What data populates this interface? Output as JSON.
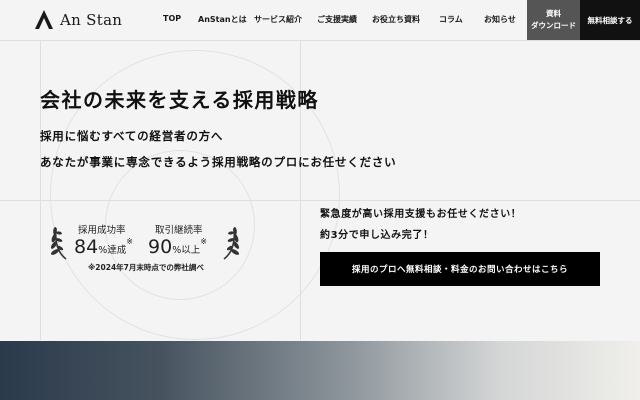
{
  "header": {
    "logo_text": "An Stan",
    "nav": [
      {
        "id": "top",
        "label": "TOP"
      },
      {
        "id": "about",
        "label": "AnStanとは"
      },
      {
        "id": "services",
        "label": "サービス紹介"
      },
      {
        "id": "cases",
        "label": "ご支援実績"
      },
      {
        "id": "resources",
        "label": "お役立ち資料"
      },
      {
        "id": "column",
        "label": "コラム"
      },
      {
        "id": "news",
        "label": "お知らせ"
      }
    ],
    "download_button": {
      "line1": "資料",
      "line2": "ダウンロード"
    },
    "consult_button": "無料相談する"
  },
  "hero": {
    "title": "会社の未来を支える採用戦略",
    "subtitle_line1": "採用に悩むすべての経営者の方へ",
    "subtitle_line2": "あなたが事業に専念できるよう採用戦略のプロにお任せください"
  },
  "stats": {
    "items": [
      {
        "label": "採用成功率",
        "value": "84",
        "unit": "%達成",
        "mark": "※"
      },
      {
        "label": "取引継続率",
        "value": "90",
        "unit": "%以上",
        "mark": "※"
      }
    ],
    "note": "※2024年7月末時点での弊社調べ"
  },
  "cta": {
    "line1": "緊急度が高い採用支援もお任せください！",
    "line2": "約3分で申し込み完了！",
    "button": "採用のプロへ無料相談・料金のお問い合わせはこちら"
  },
  "colors": {
    "background": "#f4f4f4",
    "primary_button": "#000000",
    "download_button": "#555555",
    "gradient_start": "#2b3a4c",
    "gradient_end": "#f0efeb"
  },
  "icons": [
    "logo-mark-icon",
    "laurel-left-icon",
    "laurel-right-icon"
  ]
}
